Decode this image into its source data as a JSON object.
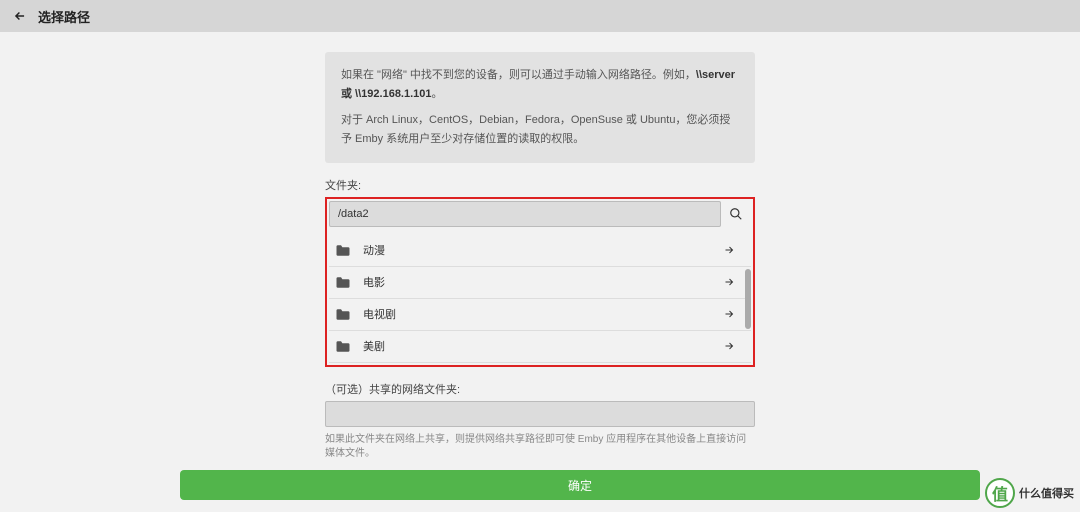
{
  "header": {
    "title": "选择路径"
  },
  "info": {
    "line1_a": "如果在 \"网络\" 中找不到您的设备，则可以通过手动输入网络路径。例如，",
    "line1_b": "\\\\server 或 \\\\192.168.1.101",
    "line1_c": "。",
    "line2": "对于 Arch Linux，CentOS，Debian，Fedora，OpenSuse 或 Ubuntu，您必须授予 Emby 系统用户至少对存储位置的读取的权限。"
  },
  "folder": {
    "label": "文件夹:",
    "path": "/data2",
    "items": [
      {
        "name": "动漫"
      },
      {
        "name": "电影"
      },
      {
        "name": "电视剧"
      },
      {
        "name": "美剧"
      }
    ]
  },
  "shared": {
    "label": "（可选）共享的网络文件夹:",
    "hint": "如果此文件夹在网络上共享，则提供网络共享路径即可使 Emby 应用程序在其他设备上直接访问媒体文件。"
  },
  "confirm": "确定",
  "badge": {
    "symbol": "值",
    "text": "什么值得买"
  }
}
